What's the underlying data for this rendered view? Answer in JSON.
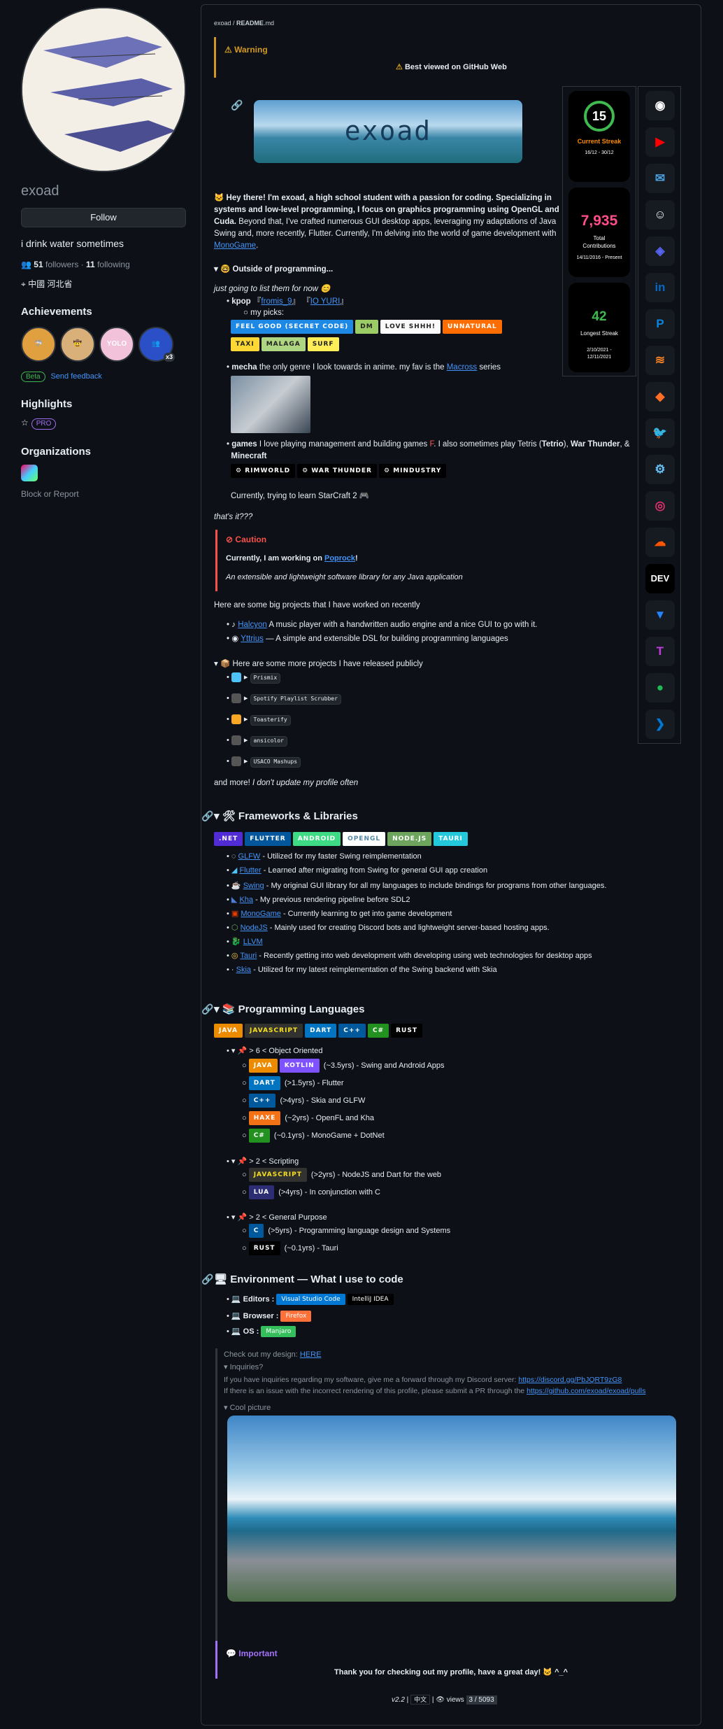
{
  "profile": {
    "username": "exoad",
    "follow": "Follow",
    "bio": "i drink water sometimes",
    "followers": "51",
    "followers_label": "followers",
    "following": "11",
    "following_label": "following",
    "location": "中國 河北省",
    "achievements_title": "Achievements",
    "beta": "Beta",
    "send_feedback": "Send feedback",
    "achievement_badge_count": "x3",
    "highlights_title": "Highlights",
    "pro": "PRO",
    "organizations_title": "Organizations",
    "block_report": "Block or Report"
  },
  "readme": {
    "breadcrumb_user": "exoad",
    "breadcrumb_file": "README",
    "breadcrumb_ext": ".md",
    "warning_title": "Warning",
    "warning_text": "Best viewed on GitHub Web",
    "banner_text": "exoad",
    "intro": "Hey there! I'm exoad, a high school student with a passion for coding. Specializing in systems and low-level programming, I focus on graphics programming using OpenGL and Cuda.",
    "intro2": "Beyond that, I've crafted numerous GUI desktop apps, leveraging my adaptations of Java Swing and, more recently, Flutter. Currently, I'm delving into the world of game development with",
    "monogame": "MonoGame",
    "outside_title": "Outside of programming...",
    "list_note": "just going to list them for now 😊",
    "kpop": "kpop",
    "kpop_1": "fromis_9",
    "kpop_2": "IO YURI",
    "my_picks": "my picks:",
    "picks": [
      "FEEL GOOD (SECRET CODE)",
      "DM",
      "LOVE SHHH!",
      "UNNATURAL",
      "TAXI",
      "MALAGA",
      "SURF"
    ],
    "mecha": "mecha",
    "mecha_text": "the only genre I look towards in anime. my fav is the",
    "macross": "Macross",
    "series": "series",
    "games": "games",
    "games_text": "I love playing management and building games",
    "games_text2": "I also sometimes play Tetris",
    "tetrio": "Tetrio",
    "warthunder": "War Thunder",
    "minecraft": "Minecraft",
    "game_badges": [
      "RIMWORLD",
      "WAR THUNDER",
      "MINDUSTRY"
    ],
    "starcraft": "Currently, trying to learn StarCraft 2",
    "thats_it": "that's it???",
    "caution_title": "Caution",
    "caution_text": "Currently, I am working on",
    "poprock": "Poprock",
    "caution_desc": "An extensible and lightweight software library for any Java application",
    "big_projects": "Here are some big projects that I have worked on recently",
    "halcyon": "Halcyon",
    "halcyon_desc": "A music player with a handwritten audio engine and a nice GUI to go with it.",
    "yttrius": "Yttrius",
    "yttrius_desc": "— A simple and extensible DSL for building programming languages",
    "more_projects": "Here are some more projects I have released publicly",
    "projects": [
      "Prismix",
      "Spotify Playlist Scrubber",
      "Toasterify",
      "ansicolor",
      "USACO Mashups"
    ],
    "and_more": "and more!",
    "and_more_i": "I don't update my profile often",
    "fw_title": "Frameworks & Libraries",
    "fw_badges": [
      ".NET",
      "FLUTTER",
      "ANDROID",
      "OPENGL",
      "NODE.JS",
      "TAURI"
    ],
    "fw_items": [
      [
        "GLFW",
        "- Utilized for my faster Swing reimplementation"
      ],
      [
        "Flutter",
        "- Learned after migrating from Swing for general GUI app creation"
      ],
      [
        "Swing",
        "- My original GUI library for all my languages to include bindings for programs from other languages."
      ],
      [
        "Kha",
        "- My previous rendering pipeline before SDL2"
      ],
      [
        "MonoGame",
        "- Currently learning to get into game development"
      ],
      [
        "NodeJS",
        "- Mainly used for creating Discord bots and lightweight server-based hosting apps."
      ],
      [
        "LLVM",
        ""
      ],
      [
        "Tauri",
        "- Recently getting into web development with developing using web technologies for desktop apps"
      ],
      [
        "Skia",
        "- Utilized for my latest reimplementation of the Swing backend with Skia"
      ]
    ],
    "pl_title": "Programming Languages",
    "pl_badges": [
      "JAVA",
      "JAVASCRIPT",
      "DART",
      "C++",
      "C#",
      "RUST"
    ],
    "oo_title": "> 6 < Object Oriented",
    "oo_items": [
      [
        "JAVA",
        "KOTLIN",
        "(~3.5yrs) - Swing and Android Apps"
      ],
      [
        "DART",
        "",
        "(>1.5yrs) - Flutter"
      ],
      [
        "C++",
        "",
        "(>4yrs) - Skia and GLFW"
      ],
      [
        "HAXE",
        "",
        "(~2yrs) - OpenFL and Kha"
      ],
      [
        "C#",
        "",
        "(~0.1yrs) - MonoGame + DotNet"
      ]
    ],
    "sc_title": "> 2 < Scripting",
    "sc_items": [
      [
        "JAVASCRIPT",
        "(>2yrs) - NodeJS and Dart for the web"
      ],
      [
        "LUA",
        "(>4yrs) - In conjunction with C"
      ]
    ],
    "gp_title": "> 2 < General Purpose",
    "gp_items": [
      [
        "C",
        "(>5yrs) - Programming language design and Systems"
      ],
      [
        "RUST",
        "(~0.1yrs) - Tauri"
      ]
    ],
    "env_title": "Environment — What I use to code",
    "editors": "Editors :",
    "vscode": "Visual Studio Code",
    "idea": "IntelliJ IDEA",
    "browser": "Browser :",
    "firefox": "Firefox",
    "os": "OS :",
    "manjaro": "Manjaro",
    "design": "Check out my design:",
    "here": "HERE",
    "inquiries": "Inquiries?",
    "inq1": "If you have inquiries regarding my software, give me a forward through my Discord server:",
    "discord_url": "https://discord.gg/PbJQRT9zG8",
    "inq2": "If there is an issue with the incorrect rendering of this profile, please submit a PR through the",
    "pulls_url": "https://github.com/exoad/exoad/pulls",
    "cool": "Cool picture",
    "important_title": "Important",
    "thanks": "Thank you for checking out my profile,",
    "great_day": "have a great day!",
    "smile": "^_^",
    "version": "v2.2",
    "lang": "中文",
    "views": "views",
    "views_count": "3 / 5093"
  },
  "streak": {
    "current": "15",
    "current_label": "Current Streak",
    "current_range": "16/12 - 30/12",
    "total": "7,935",
    "total_label": "Total Contributions",
    "total_range": "14/11/2016 - Present",
    "longest": "42",
    "longest_label": "Longest Streak",
    "longest_range": "2/10/2021 - 12/11/2021"
  },
  "social_icons": [
    "github-icon",
    "youtube-icon",
    "email-icon",
    "reddit-icon",
    "discord-icon",
    "linkedin-icon",
    "paypal-icon",
    "stackoverflow-icon",
    "gitlab-icon",
    "twitter-icon",
    "steam-icon",
    "instagram-icon",
    "soundcloud-icon",
    "dev-icon",
    "bitbucket-icon",
    "tumblr-icon",
    "spotify-icon",
    "vscode-icon"
  ],
  "colors": {
    "accent": "#4493f8",
    "warning": "#d29922",
    "caution": "#f85149",
    "important": "#a371f7",
    "streak_fire": "#fb8c00",
    "streak_ring": "#3fb950",
    "total_pink": "#ff4d8a"
  }
}
